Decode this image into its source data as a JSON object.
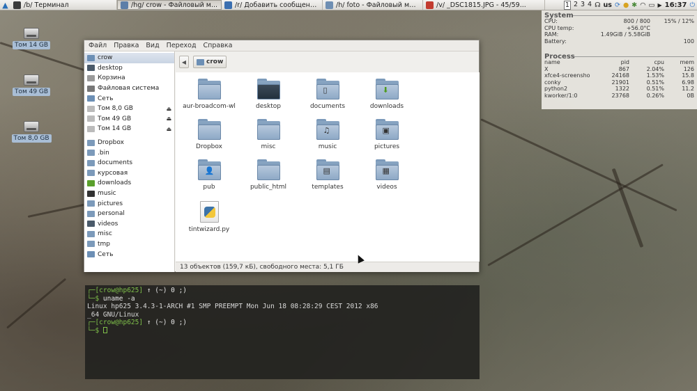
{
  "taskbar": {
    "tasks": [
      {
        "label": "/b/  Терминал",
        "color": "#3a3a3a"
      },
      {
        "label": "/hg/  crow - Файловый м...",
        "color": "#5d7fa8"
      },
      {
        "label": "/r/  Добавить сообщени...",
        "color": "#3b6fb0"
      },
      {
        "label": "/h/  foto - Файловый ме...",
        "color": "#6f8fb3"
      },
      {
        "label": "/v/  _DSC1815.JPG - 45/59...",
        "color": "#c23b2f"
      }
    ],
    "workspaces": [
      "1",
      "2",
      "3",
      "4"
    ],
    "keyboard": "us",
    "clock": "16:37"
  },
  "desktop": {
    "drives": [
      "Том 14 GB",
      "Том 49 GB",
      "Том 8,0 GB"
    ]
  },
  "conky": {
    "system_title": "System",
    "rows": [
      {
        "k": "CPU:",
        "v1": "800 / 800",
        "v2": "15% / 12%"
      },
      {
        "k": "CPU temp:",
        "v1": "+56.0°C",
        "v2": ""
      },
      {
        "k": "RAM:",
        "v1": "1.49GiB / 5.58GiB",
        "v2": ""
      },
      {
        "k": "Battery:",
        "v1": "",
        "v2": "100"
      }
    ],
    "process_title": "Process",
    "process_headers": [
      "name",
      "pid",
      "cpu",
      "mem"
    ],
    "processes": [
      [
        "X",
        "867",
        "2.04%",
        "126"
      ],
      [
        "xfce4-screensho",
        "24168",
        "1.53%",
        "15.8"
      ],
      [
        "conky",
        "21901",
        "0.51%",
        "6.98"
      ],
      [
        "python2",
        "1322",
        "0.51%",
        "11.2"
      ],
      [
        "kworker/1:0",
        "23768",
        "0.26%",
        "0B"
      ]
    ]
  },
  "file_manager": {
    "menu": [
      "Файл",
      "Правка",
      "Вид",
      "Переход",
      "Справка"
    ],
    "sidebar": [
      {
        "label": "crow",
        "selected": true,
        "color": "#6c8fb5"
      },
      {
        "label": "desktop",
        "color": "#4a5a6a"
      },
      {
        "label": "Корзина",
        "color": "#9a9a9a"
      },
      {
        "label": "Файловая система",
        "color": "#777777"
      },
      {
        "label": "Сеть",
        "color": "#6c8fb5"
      },
      {
        "label": "Том 8,0 GB",
        "eject": true,
        "color": "#bbbbbb"
      },
      {
        "label": "Том 49 GB",
        "eject": true,
        "color": "#bbbbbb"
      },
      {
        "label": "Том 14 GB",
        "eject": true,
        "color": "#bbbbbb"
      },
      {
        "gap": true
      },
      {
        "label": "Dropbox",
        "color": "#7c9aba"
      },
      {
        "label": ".bin",
        "color": "#7c9aba"
      },
      {
        "label": "documents",
        "color": "#7c9aba"
      },
      {
        "label": "курсовая",
        "color": "#7c9aba"
      },
      {
        "label": "downloads",
        "color": "#5aa02c"
      },
      {
        "label": "music",
        "color": "#333333"
      },
      {
        "label": "pictures",
        "color": "#7c9aba"
      },
      {
        "label": "personal",
        "color": "#7c9aba"
      },
      {
        "label": "videos",
        "color": "#4a5a6a"
      },
      {
        "label": "misc",
        "color": "#7c9aba"
      },
      {
        "label": "tmp",
        "color": "#7c9aba"
      },
      {
        "label": "Сеть",
        "color": "#6c8fb5"
      }
    ],
    "location": "crow",
    "items": [
      {
        "name": "aur-broadcom-wl",
        "icon": "folder-icon",
        "emblem": ""
      },
      {
        "name": "desktop",
        "icon": "desktop-folder-icon",
        "emblem": ""
      },
      {
        "name": "documents",
        "icon": "documents-folder-icon",
        "emblem": "▯"
      },
      {
        "name": "downloads",
        "icon": "downloads-folder-icon",
        "emblem": "⬇"
      },
      {
        "name": "Dropbox",
        "icon": "folder-icon",
        "emblem": ""
      },
      {
        "name": "misc",
        "icon": "folder-icon",
        "emblem": ""
      },
      {
        "name": "music",
        "icon": "music-folder-icon",
        "emblem": "♫"
      },
      {
        "name": "pictures",
        "icon": "pictures-folder-icon",
        "emblem": "▣"
      },
      {
        "name": "pub",
        "icon": "public-folder-icon",
        "emblem": "👤"
      },
      {
        "name": "public_html",
        "icon": "folder-icon",
        "emblem": ""
      },
      {
        "name": "templates",
        "icon": "templates-folder-icon",
        "emblem": "▤"
      },
      {
        "name": "videos",
        "icon": "videos-folder-icon",
        "emblem": "▦"
      },
      {
        "name": "tintwizard.py",
        "icon": "python-file-icon",
        "emblem": ""
      }
    ],
    "status": "13 объектов (159,7 кБ), свободного места: 5,1 ГБ"
  },
  "terminal": {
    "prompt_user": "crow@hp625",
    "prompt_rest": " ↑ (~) 0 ;)",
    "command": "uname -a",
    "output": [
      "Linux hp625 3.4.3-1-ARCH #1 SMP PREEMPT Mon Jun 18 08:28:29 CEST 2012 x86",
      "_64 GNU/Linux"
    ]
  }
}
